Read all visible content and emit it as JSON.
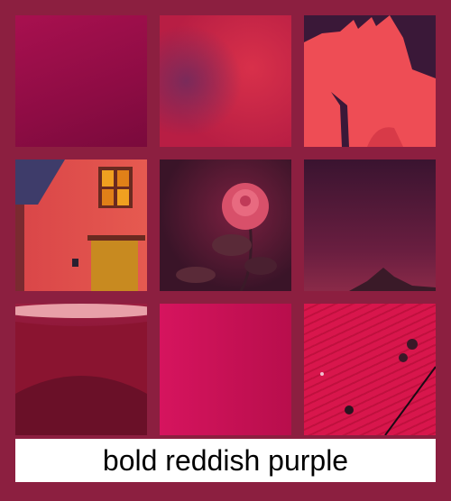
{
  "caption": "bold reddish purple",
  "colors": {
    "background": "#8c1f40",
    "caption_bg": "#ffffff"
  },
  "tiles": [
    "fabric-drape",
    "watercolor-texture",
    "furry-creature",
    "cottage-window-door",
    "rose",
    "dark-sky-mountain",
    "cup-closeup",
    "pink-gradient",
    "wet-wood-planks"
  ]
}
